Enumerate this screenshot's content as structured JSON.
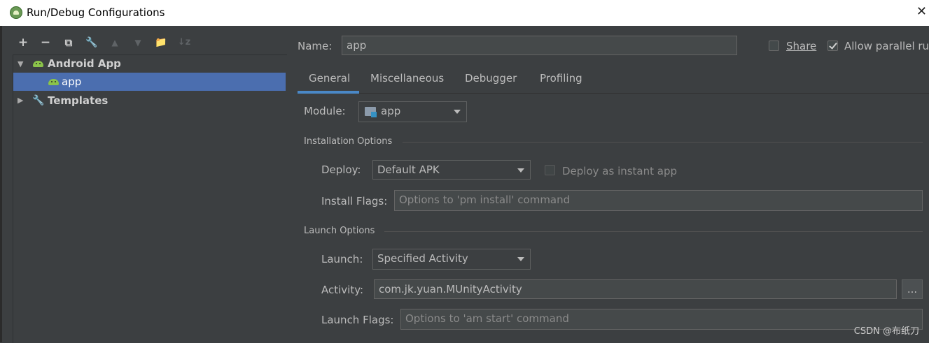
{
  "window": {
    "title": "Run/Debug Configurations",
    "close_glyph": "✕"
  },
  "toolbar": {
    "add": "+",
    "remove": "−",
    "copy": "⧉",
    "edit": "🔧",
    "move_up": "▲",
    "move_down": "▼",
    "new_folder": "📁",
    "sort": "↓z"
  },
  "tree": {
    "group_label": "Android App",
    "app_label": "app",
    "templates_label": "Templates"
  },
  "form": {
    "name_label": "Name:",
    "name_value": "app",
    "share_label": "Share",
    "allow_parallel_label": "Allow parallel ru"
  },
  "tabs": [
    "General",
    "Miscellaneous",
    "Debugger",
    "Profiling"
  ],
  "general": {
    "module_label": "Module:",
    "module_value": "app",
    "installation_section": "Installation Options",
    "deploy_label": "Deploy:",
    "deploy_value": "Default APK",
    "instant_app_label": "Deploy as instant app",
    "install_flags_label": "Install Flags:",
    "install_flags_placeholder": "Options to 'pm install' command",
    "launch_section": "Launch Options",
    "launch_label": "Launch:",
    "launch_value": "Specified Activity",
    "activity_label": "Activity:",
    "activity_value": "com.jk.yuan.MUnityActivity",
    "browse_label": "...",
    "launch_flags_label": "Launch Flags:",
    "launch_flags_placeholder": "Options to 'am start' command"
  },
  "watermark": "CSDN @布纸刀",
  "colors": {
    "background": "#3c3f41",
    "selection": "#4b6eaf",
    "tab_underline": "#4a88c7"
  }
}
